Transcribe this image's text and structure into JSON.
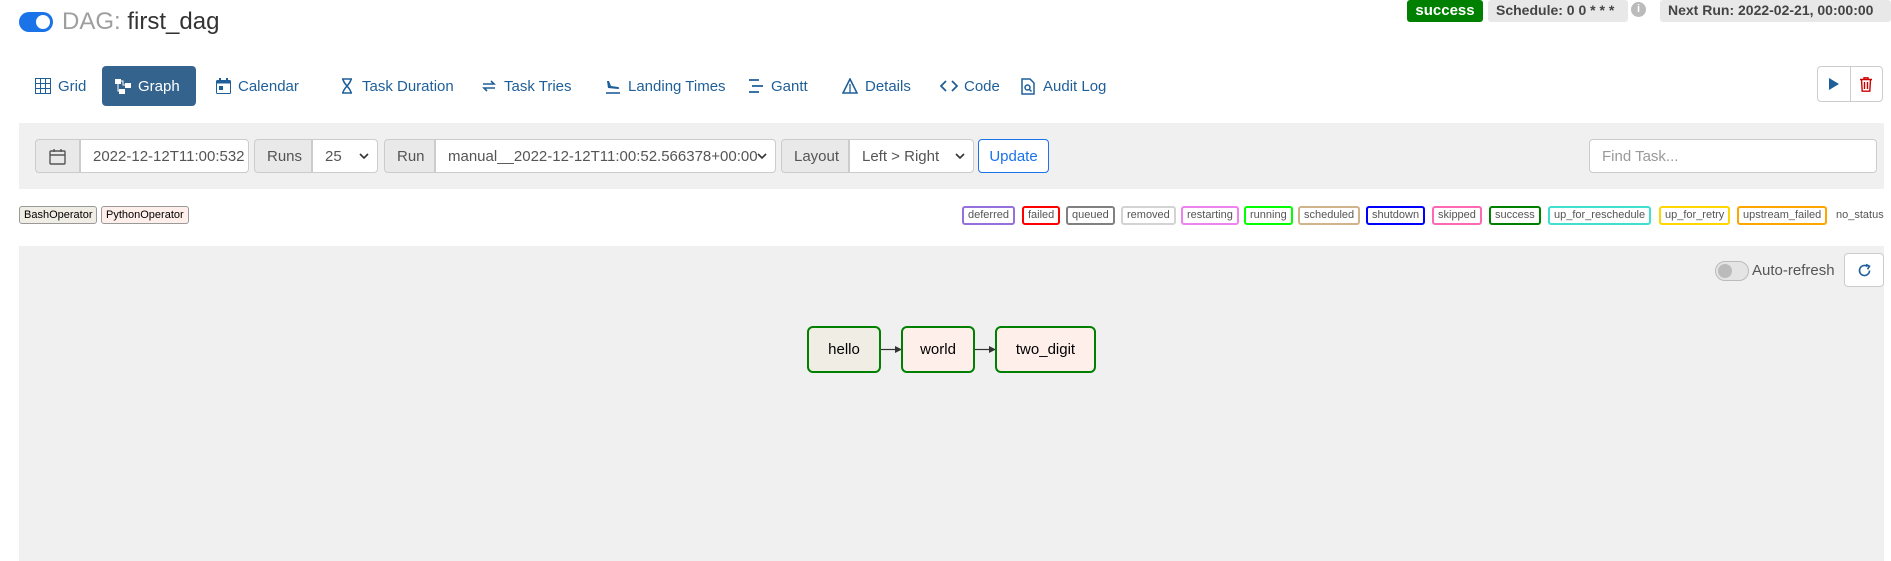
{
  "header": {
    "dag_prefix": "DAG:",
    "dag_id": "first_dag",
    "status": "success",
    "schedule": "Schedule: 0 0 * * *",
    "next_run": "Next Run: 2022-02-21, 00:00:00",
    "info_glyph": "i"
  },
  "tabs": [
    {
      "label": "Grid",
      "icon": "grid-icon"
    },
    {
      "label": "Graph",
      "icon": "graph-icon",
      "active": true
    },
    {
      "label": "Calendar",
      "icon": "calendar-icon"
    },
    {
      "label": "Task Duration",
      "icon": "hourglass-icon"
    },
    {
      "label": "Task Tries",
      "icon": "retry-icon"
    },
    {
      "label": "Landing Times",
      "icon": "plane-landing-icon"
    },
    {
      "label": "Gantt",
      "icon": "gantt-icon"
    },
    {
      "label": "Details",
      "icon": "triangle-icon"
    },
    {
      "label": "Code",
      "icon": "code-icon"
    },
    {
      "label": "Audit Log",
      "icon": "file-search-icon"
    }
  ],
  "filters": {
    "execution_date": "2022-12-12T11:00:532",
    "runs_label": "Runs",
    "runs_value": "25",
    "run_label": "Run",
    "run_value": "manual__2022-12-12T11:00:52.566378+00:00",
    "layout_label": "Layout",
    "layout_value": "Left > Right",
    "update_label": "Update",
    "find_placeholder": "Find Task..."
  },
  "operators": [
    {
      "label": "BashOperator",
      "color": "#f0ede4"
    },
    {
      "label": "PythonOperator",
      "color": "#ffefeb"
    }
  ],
  "states": [
    {
      "label": "deferred",
      "color": "#9370db"
    },
    {
      "label": "failed",
      "color": "#ff0000"
    },
    {
      "label": "queued",
      "color": "#808080"
    },
    {
      "label": "removed",
      "color": "#d3d3d3"
    },
    {
      "label": "restarting",
      "color": "#ee82ee"
    },
    {
      "label": "running",
      "color": "#00ff00"
    },
    {
      "label": "scheduled",
      "color": "#d2b48c"
    },
    {
      "label": "shutdown",
      "color": "#0000ff"
    },
    {
      "label": "skipped",
      "color": "#ff69b4"
    },
    {
      "label": "success",
      "color": "#008000"
    },
    {
      "label": "up_for_reschedule",
      "color": "#40e0d0"
    },
    {
      "label": "up_for_retry",
      "color": "#ffd700"
    },
    {
      "label": "upstream_failed",
      "color": "#ffa500"
    },
    {
      "label": "no_status",
      "color": "#ffffff"
    }
  ],
  "graph": {
    "auto_refresh_label": "Auto-refresh",
    "nodes": [
      {
        "id": "hello",
        "fill": "#f0ede4",
        "state_color": "#008000"
      },
      {
        "id": "world",
        "fill": "#ffefeb",
        "state_color": "#008000"
      },
      {
        "id": "two_digit",
        "fill": "#ffefeb",
        "state_color": "#008000"
      }
    ]
  },
  "colors": {
    "brand_blue": "#1a73e8",
    "active_tab": "#34638e",
    "link": "#1f5f99",
    "delete_red": "#cc0000"
  }
}
